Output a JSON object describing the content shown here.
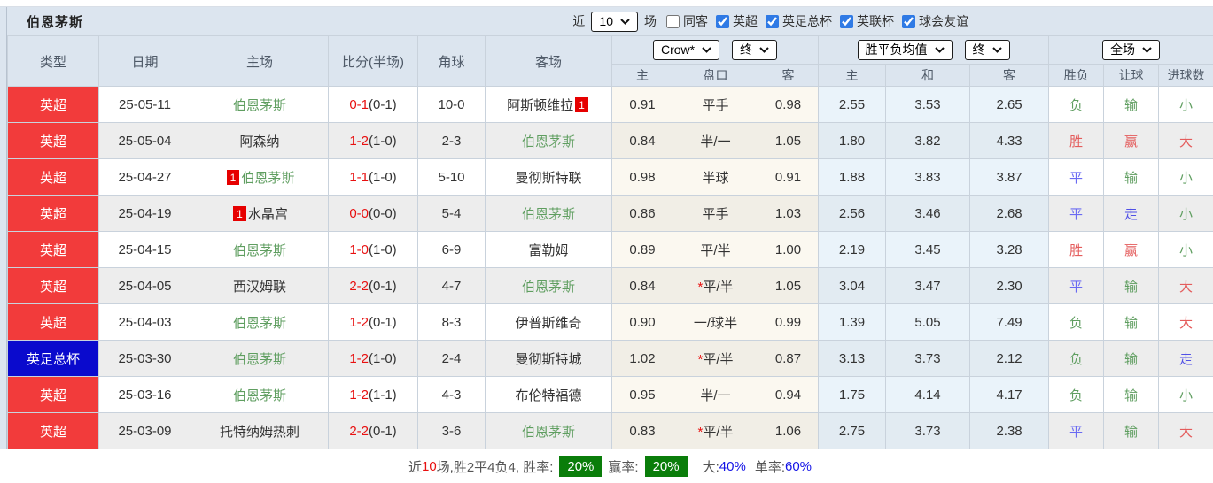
{
  "team_title": "伯恩茅斯",
  "filter_bar": {
    "recent_label": "近",
    "recent_select": "10",
    "games_label": "场",
    "checkboxes": [
      {
        "label": "同客",
        "checked": false
      },
      {
        "label": "英超",
        "checked": true
      },
      {
        "label": "英足总杯",
        "checked": true
      },
      {
        "label": "英联杯",
        "checked": true
      },
      {
        "label": "球会友谊",
        "checked": true
      }
    ]
  },
  "header": {
    "static_cols": [
      "类型",
      "日期",
      "主场",
      "比分(半场)",
      "角球",
      "客场"
    ],
    "odds_group": {
      "select1": "Crow*",
      "select2": "终",
      "sub": [
        "主",
        "盘口",
        "客"
      ]
    },
    "mean_group": {
      "select1": "胜平负均值",
      "select2": "终",
      "sub": [
        "主",
        "和",
        "客"
      ]
    },
    "result_group": {
      "select1": "全场",
      "sub": [
        "胜负",
        "让球",
        "进球数"
      ]
    }
  },
  "rows": [
    {
      "type": "英超",
      "type_color": "#f23b3b",
      "date": "25-05-11",
      "home": {
        "name": "伯恩茅斯",
        "green": true,
        "badge": ""
      },
      "score_ft": "0-1",
      "score_ht": "(0-1)",
      "corner": "10-0",
      "away": {
        "name": "阿斯顿维拉",
        "green": false,
        "badge": "1",
        "badge_side": "after"
      },
      "odds": [
        "0.91",
        "平手",
        "0.98"
      ],
      "mean": [
        "2.55",
        "3.53",
        "2.65"
      ],
      "results": [
        "负",
        "输",
        "小"
      ]
    },
    {
      "type": "英超",
      "type_color": "#f23b3b",
      "date": "25-05-04",
      "home": {
        "name": "阿森纳",
        "green": false,
        "badge": ""
      },
      "score_ft": "1-2",
      "score_ht": "(1-0)",
      "corner": "2-3",
      "away": {
        "name": "伯恩茅斯",
        "green": true,
        "badge": ""
      },
      "odds": [
        "0.84",
        "半/一",
        "1.05"
      ],
      "mean": [
        "1.80",
        "3.82",
        "4.33"
      ],
      "results": [
        "胜",
        "赢",
        "大"
      ]
    },
    {
      "type": "英超",
      "type_color": "#f23b3b",
      "date": "25-04-27",
      "home": {
        "name": "伯恩茅斯",
        "green": true,
        "badge": "1",
        "badge_side": "before"
      },
      "score_ft": "1-1",
      "score_ht": "(1-0)",
      "corner": "5-10",
      "away": {
        "name": "曼彻斯特联",
        "green": false,
        "badge": ""
      },
      "odds": [
        "0.98",
        "半球",
        "0.91"
      ],
      "mean": [
        "1.88",
        "3.83",
        "3.87"
      ],
      "results": [
        "平",
        "输",
        "小"
      ]
    },
    {
      "type": "英超",
      "type_color": "#f23b3b",
      "date": "25-04-19",
      "home": {
        "name": "水晶宫",
        "green": false,
        "badge": "1",
        "badge_side": "before"
      },
      "score_ft": "0-0",
      "score_ht": "(0-0)",
      "corner": "5-4",
      "away": {
        "name": "伯恩茅斯",
        "green": true,
        "badge": ""
      },
      "odds": [
        "0.86",
        "平手",
        "1.03"
      ],
      "mean": [
        "2.56",
        "3.46",
        "2.68"
      ],
      "results": [
        "平",
        "走",
        "小"
      ]
    },
    {
      "type": "英超",
      "type_color": "#f23b3b",
      "date": "25-04-15",
      "home": {
        "name": "伯恩茅斯",
        "green": true,
        "badge": ""
      },
      "score_ft": "1-0",
      "score_ht": "(1-0)",
      "corner": "6-9",
      "away": {
        "name": "富勒姆",
        "green": false,
        "badge": ""
      },
      "odds": [
        "0.89",
        "平/半",
        "1.00"
      ],
      "mean": [
        "2.19",
        "3.45",
        "3.28"
      ],
      "results": [
        "胜",
        "赢",
        "小"
      ]
    },
    {
      "type": "英超",
      "type_color": "#f23b3b",
      "date": "25-04-05",
      "home": {
        "name": "西汉姆联",
        "green": false,
        "badge": ""
      },
      "score_ft": "2-2",
      "score_ht": "(0-1)",
      "corner": "4-7",
      "away": {
        "name": "伯恩茅斯",
        "green": true,
        "badge": ""
      },
      "odds": [
        "0.84",
        "*平/半",
        "1.05"
      ],
      "mean": [
        "3.04",
        "3.47",
        "2.30"
      ],
      "results": [
        "平",
        "输",
        "大"
      ]
    },
    {
      "type": "英超",
      "type_color": "#f23b3b",
      "date": "25-04-03",
      "home": {
        "name": "伯恩茅斯",
        "green": true,
        "badge": ""
      },
      "score_ft": "1-2",
      "score_ht": "(0-1)",
      "corner": "8-3",
      "away": {
        "name": "伊普斯维奇",
        "green": false,
        "badge": ""
      },
      "odds": [
        "0.90",
        "一/球半",
        "0.99"
      ],
      "mean": [
        "1.39",
        "5.05",
        "7.49"
      ],
      "results": [
        "负",
        "输",
        "大"
      ]
    },
    {
      "type": "英足总杯",
      "type_color": "#0a0acd",
      "date": "25-03-30",
      "home": {
        "name": "伯恩茅斯",
        "green": true,
        "badge": ""
      },
      "score_ft": "1-2",
      "score_ht": "(1-0)",
      "corner": "2-4",
      "away": {
        "name": "曼彻斯特城",
        "green": false,
        "badge": ""
      },
      "odds": [
        "1.02",
        "*平/半",
        "0.87"
      ],
      "mean": [
        "3.13",
        "3.73",
        "2.12"
      ],
      "results": [
        "负",
        "输",
        "走"
      ]
    },
    {
      "type": "英超",
      "type_color": "#f23b3b",
      "date": "25-03-16",
      "home": {
        "name": "伯恩茅斯",
        "green": true,
        "badge": ""
      },
      "score_ft": "1-2",
      "score_ht": "(1-1)",
      "corner": "4-3",
      "away": {
        "name": "布伦特福德",
        "green": false,
        "badge": ""
      },
      "odds": [
        "0.95",
        "半/一",
        "0.94"
      ],
      "mean": [
        "1.75",
        "4.14",
        "4.17"
      ],
      "results": [
        "负",
        "输",
        "小"
      ]
    },
    {
      "type": "英超",
      "type_color": "#f23b3b",
      "date": "25-03-09",
      "home": {
        "name": "托特纳姆热刺",
        "green": false,
        "badge": ""
      },
      "score_ft": "2-2",
      "score_ht": "(0-1)",
      "corner": "3-6",
      "away": {
        "name": "伯恩茅斯",
        "green": true,
        "badge": ""
      },
      "odds": [
        "0.83",
        "*平/半",
        "1.06"
      ],
      "mean": [
        "2.75",
        "3.73",
        "2.38"
      ],
      "results": [
        "平",
        "输",
        "大"
      ]
    }
  ],
  "footer": {
    "prefix": "近",
    "count": "10",
    "summary": "场,胜2平4负4, 胜率:",
    "win_rate": "20%",
    "odds_rate_label": "赢率:",
    "odds_rate": "20%",
    "big_label": "大:",
    "big_value": "40%",
    "single_label": "单率:",
    "single_value": "60%"
  },
  "colors": {
    "league_red": "#f23b3b",
    "cup_blue": "#0a0acd",
    "team_green": "#5f9e60",
    "score_red": "#e81010",
    "badge_red": "#e60000",
    "rate_badge_green": "#0a7d0a",
    "percent_blue": "#1414e6",
    "result_map": {
      "胜": "#e45c5c",
      "赢": "#e45c5c",
      "大": "#e45c5c",
      "平": "#6a6af2",
      "走": "#5050e6",
      "负": "#5f9e60",
      "输": "#5f9e60",
      "小": "#5f9e60"
    }
  }
}
